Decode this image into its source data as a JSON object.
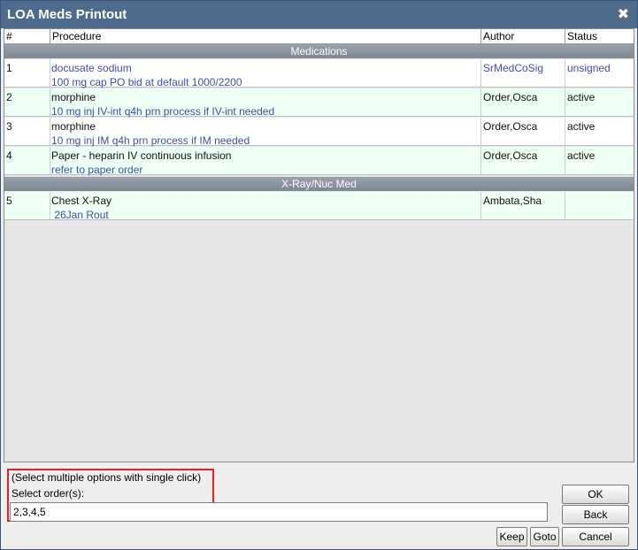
{
  "window": {
    "title": "LOA Meds Printout",
    "close_glyph": "✖"
  },
  "columns": {
    "num": "#",
    "procedure": "Procedure",
    "author": "Author",
    "status": "Status"
  },
  "sections": [
    {
      "label": "Medications"
    },
    {
      "label": "X-Ray/Nuc Med"
    }
  ],
  "rows": [
    {
      "num": "1",
      "line1": "docusate sodium",
      "line2": "100 mg cap PO bid at default 1000/2200",
      "author": "SrMedCoSig",
      "status": "unsigned"
    },
    {
      "num": "2",
      "line1": "morphine",
      "line2": "10 mg inj IV-int q4h prn process if IV-int needed",
      "author": "Order,Osca",
      "status": "active"
    },
    {
      "num": "3",
      "line1": "morphine",
      "line2": "10 mg inj IM q4h prn process if IM needed",
      "author": "Order,Osca",
      "status": "active"
    },
    {
      "num": "4",
      "line1": "Paper - heparin IV continuous infusion",
      "line2": "refer to paper order",
      "author": "Order,Osca",
      "status": "active"
    },
    {
      "num": "5",
      "line1": "Chest X-Ray",
      "line2": " 26Jan Rout",
      "author": "Ambata,Sha",
      "status": ""
    }
  ],
  "footer": {
    "hint": "(Select multiple options with single click)",
    "select_label": "Select order(s):",
    "select_value": "2,3,4,5",
    "buttons": {
      "ok": "OK",
      "back": "Back",
      "keep": "Keep",
      "goto": "Goto",
      "cancel": "Cancel"
    }
  }
}
